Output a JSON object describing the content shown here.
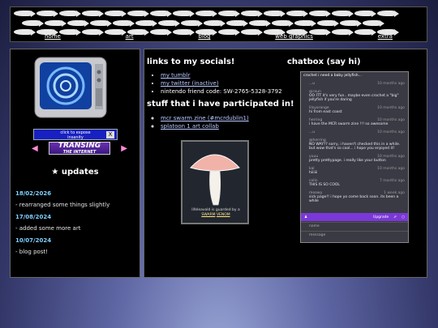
{
  "nav": {
    "links": [
      "home",
      "art",
      "blog",
      "web graphics",
      "extra"
    ]
  },
  "left": {
    "badge_line1": "click to expose",
    "badge_line2": "insanity",
    "badge_close": "X",
    "transing_main": "TRANSING",
    "transing_sub": "THE INTERNET",
    "updates_title": "★ updates",
    "updates": [
      {
        "date": "18/02/2026",
        "text": "- rearranged some things slightly"
      },
      {
        "date": "17/08/2024",
        "text": "- added some more art"
      },
      {
        "date": "10/07/2024",
        "text": "- blog post!"
      }
    ]
  },
  "main": {
    "socials_title": "links to my socials!",
    "socials": {
      "tumblr": "my tumblr",
      "twitter": "my twitter (inactive)",
      "nintendo": "nintendo friend code: SW-2765-5328-3792"
    },
    "participated_title": "stuff that i have participated in!",
    "participated": [
      "mcr swarm zine (#mcrdublin1)",
      "splatoon 1 art collab"
    ],
    "mushroom_caption_pre": "lifeleavold is guarded by a",
    "mushroom_caption_link": "SWARM",
    "mushroom_caption_link2": "VENOM"
  },
  "chat": {
    "title": "chatbox (say hi)",
    "top_text": "crochet i need a baby jellyfish...",
    "messages": [
      {
        "name": "...u",
        "ago": "10 months ago",
        "text": ""
      },
      {
        "name": "@raun",
        "ago": "",
        "text": "OO ITT it's very fun.. maybe even crochet a \"big\" jellyfish if you're daring"
      },
      {
        "name": "lilsyorange",
        "ago": "10 months ago",
        "text": "hi from east coast"
      },
      {
        "name": "herring",
        "ago": "10 months ago",
        "text": "i have the MCR swarm zine !!! so awesome"
      },
      {
        "name": "...u",
        "ago": "10 months ago",
        "text": ""
      },
      {
        "name": "@herring",
        "ago": "",
        "text": "NO WAY?? sorry, i haven't checked this in a while. but wow that's so cool... i hope you enjoyed it!"
      },
      {
        "name": "yuuu",
        "ago": "10 months ago",
        "text": "pretty prettypage. i really like your button"
      },
      {
        "name": "kal",
        "ago": "10 months ago",
        "text": "hiiiiii"
      },
      {
        "name": "colin",
        "ago": "7 months ago",
        "text": "THIS IS SO COOL"
      },
      {
        "name": "meowy",
        "ago": "1 week ago",
        "text": "sick page!! i hope yo come back soon. its been a while"
      }
    ],
    "bar_upgrade": "Upgrade",
    "name_placeholder": "name",
    "message_placeholder": "message"
  }
}
